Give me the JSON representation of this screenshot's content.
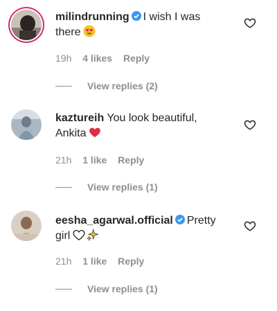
{
  "comments": [
    {
      "username": "milindrunning",
      "text_line1": "I wish I was",
      "text_line2": "there",
      "emoji": "heart-eyes-emoji",
      "verified": true,
      "time": "19h",
      "likes": "4 likes",
      "reply": "Reply",
      "view_replies": "View replies (2)"
    },
    {
      "username": "kaztureih",
      "text_line1": "You look beautiful,",
      "text_line2": "Ankita",
      "emoji": "red-heart-emoji",
      "verified": false,
      "time": "21h",
      "likes": "1 like",
      "reply": "Reply",
      "view_replies": "View replies (1)"
    },
    {
      "username": "eesha_agarwal.official",
      "text_line1": "Pretty",
      "text_line2": "girl",
      "emoji": "white-heart-sparkles-emoji",
      "verified": true,
      "time": "21h",
      "likes": "1 like",
      "reply": "Reply",
      "view_replies": "View replies (1)"
    }
  ],
  "colors": {
    "text": "#262626",
    "muted": "#8e8e8e",
    "verified": "#3897f0",
    "story_ring": "#d62976"
  }
}
